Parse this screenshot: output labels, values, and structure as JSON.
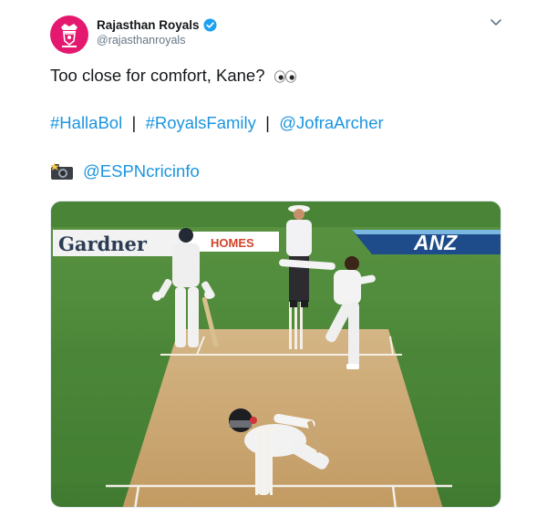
{
  "account": {
    "display_name": "Rajasthan Royals",
    "handle": "@rajasthanroyals",
    "verified": true,
    "avatar_icon": "rajasthan-royals-logo-icon"
  },
  "tweet": {
    "line1": "Too close for comfort, Kane?",
    "hashtags": [
      {
        "text": "#HallaBol"
      },
      {
        "text": "#RoyalsFamily"
      },
      {
        "text": "@JofraArcher"
      }
    ],
    "separator": "|",
    "photo_credit": "@ESPNcricinfo",
    "emoji_line1": "eyes-icon",
    "emoji_credit": "camera-flash-icon"
  },
  "media": {
    "boards": {
      "left": "Gardner",
      "middle": "HOMES",
      "right": "ANZ"
    },
    "colors": {
      "grass": "#4f8a3a",
      "pitch": "#c9a572",
      "brand": "#e5186f",
      "link": "#1b95e0"
    }
  }
}
